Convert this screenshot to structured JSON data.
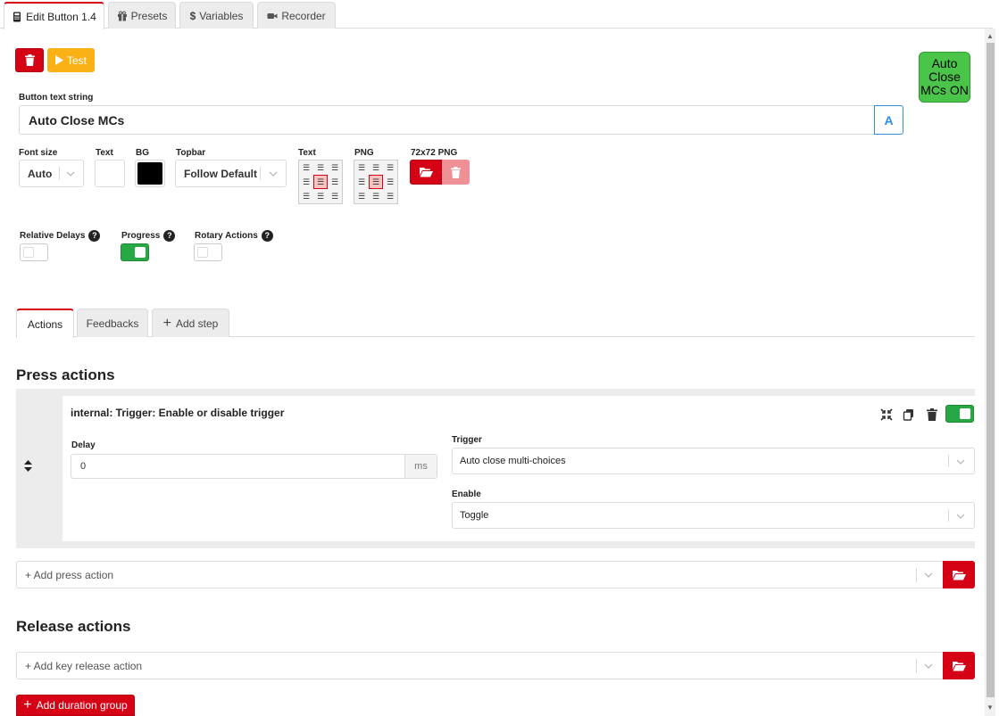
{
  "tabs": [
    {
      "label": "Edit Button 1.4",
      "icon": "calculator-icon"
    },
    {
      "label": "Presets",
      "icon": "gift-icon"
    },
    {
      "label": "Variables",
      "icon": "dollar-icon"
    },
    {
      "label": "Recorder",
      "icon": "video-icon"
    }
  ],
  "toolbar": {
    "test_label": "Test"
  },
  "preview_text": "Auto Close MCs ON",
  "button_text": {
    "label": "Button text string",
    "value": "Auto Close MCs",
    "expr_toggle": "A"
  },
  "style": {
    "font_size_label": "Font size",
    "font_size_value": "Auto",
    "text_color_label": "Text",
    "bg_label": "BG",
    "topbar_label": "Topbar",
    "topbar_value": "Follow Default",
    "text_align_label": "Text",
    "png_align_label": "PNG",
    "png_label": "72x72 PNG",
    "text_color": "#ffffff",
    "bg_color": "#000000"
  },
  "options": {
    "relative_delays_label": "Relative Delays",
    "progress_label": "Progress",
    "rotary_label": "Rotary Actions",
    "help_glyph": "?",
    "relative_delays_on": false,
    "progress_on": true,
    "rotary_on": false
  },
  "subtabs": {
    "actions": "Actions",
    "feedbacks": "Feedbacks",
    "add_step": "Add step"
  },
  "press": {
    "heading": "Press actions",
    "action": {
      "title": "internal: Trigger: Enable or disable trigger",
      "delay_label": "Delay",
      "delay_value": "0",
      "delay_unit": "ms",
      "trigger_label": "Trigger",
      "trigger_value": "Auto close multi-choices",
      "enable_label": "Enable",
      "enable_value": "Toggle",
      "enabled": true
    },
    "add_placeholder": "+ Add press action"
  },
  "release": {
    "heading": "Release actions",
    "add_placeholder": "+ Add key release action"
  },
  "add_duration_group": "Add duration group",
  "colors": {
    "accent_red": "#d50215",
    "success_green": "#28a745",
    "test_yellow": "#f9b115",
    "preview_green": "#4ac54a"
  }
}
